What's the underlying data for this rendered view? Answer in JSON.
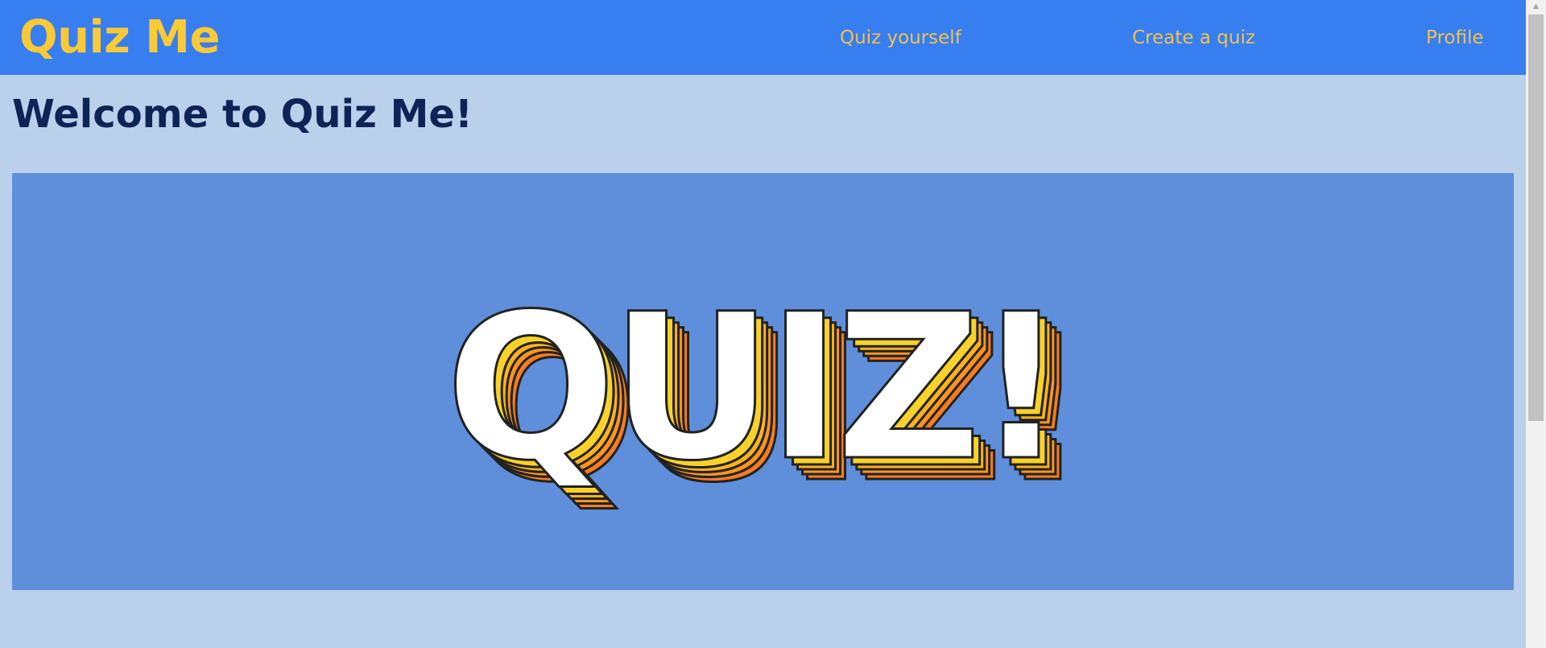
{
  "navbar": {
    "brand": "Quiz Me",
    "links": [
      "Quiz yourself",
      "Create a quiz",
      "Profile"
    ]
  },
  "main": {
    "heading": "Welcome to Quiz Me!",
    "hero_text": "QUIZ!"
  },
  "scrollbar": {
    "up_arrow_icon": "triangle-up-icon"
  },
  "colors": {
    "navbar_bg": "#377ef0",
    "brand": "#f9c936",
    "nav_link": "#f1c24e",
    "page_bg": "#bbd0ea",
    "heading": "#0e2456",
    "hero_bg": "#5f8fdb",
    "logo_yellow": "#f8d22a",
    "logo_orange": "#f47d20"
  }
}
